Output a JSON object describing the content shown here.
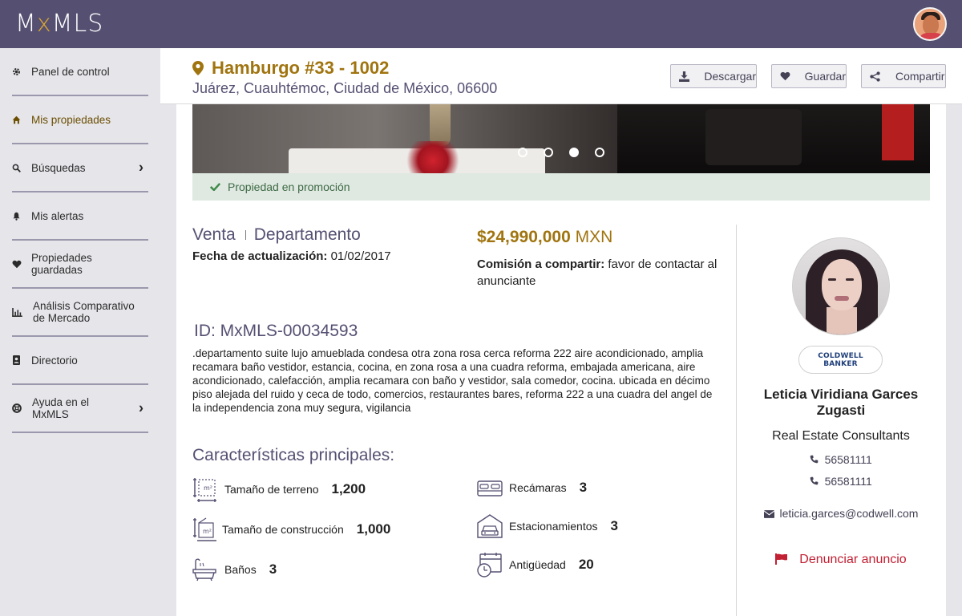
{
  "topbar": {
    "logo_prefix": "M",
    "logo_x": "x",
    "logo_suffix": "MLS"
  },
  "sidebar": {
    "items": [
      {
        "label": "Panel de control",
        "icon": "gear-icon"
      },
      {
        "label": "Mis propiedades",
        "icon": "home-icon"
      },
      {
        "label": "Búsquedas",
        "icon": "search-icon"
      },
      {
        "label": "Mis alertas",
        "icon": "bell-icon"
      },
      {
        "label": "Propiedades guardadas",
        "icon": "heart-icon"
      },
      {
        "label": "Análisis Comparativo de Mercado",
        "icon": "bar-chart-icon"
      },
      {
        "label": "Directorio",
        "icon": "contact-card-icon"
      },
      {
        "label": "Ayuda en el MxMLS",
        "icon": "lifebuoy-icon"
      }
    ]
  },
  "header": {
    "title": "Hamburgo #33 - 1002",
    "address": "Juárez, Cuauhtémoc, Ciudad de México, 06600",
    "buttons": {
      "download": "Descargar",
      "save": "Guardar",
      "share": "Compartir"
    }
  },
  "gallery": {
    "active_slide": 3,
    "total_slides": 4
  },
  "promo": {
    "text": "Propiedad en promoción"
  },
  "listing": {
    "operation": "Venta",
    "property_type": "Departamento",
    "updated_label": "Fecha de actualización:",
    "updated_value": "01/02/2017",
    "price": "$24,990,000",
    "currency": "MXN",
    "commission_label": "Comisión a compartir:",
    "commission_value": "favor de contactar al anunciante",
    "id_text": "ID: MxMLS-00034593",
    "description": ".departamento suite lujo amueblada condesa otra zona rosa cerca reforma 222 aire acondicionado, amplia recamara baño vestidor, estancia, cocina, en zona rosa a una cuadra reforma, embajada americana, aire acondicionado, calefacción, amplia recamara con baño y vestidor, sala comedor, cocina. ubicada en décimo piso alejada del ruido y ceca de todo, comercios, restaurantes bares, reforma 222 a una cuadra del angel de la independencia zona muy segura, vigilancia"
  },
  "features": {
    "title": "Características principales:",
    "lot_size": {
      "label": "Tamaño de terreno",
      "value": "1,200"
    },
    "built_size": {
      "label": "Tamaño de construcción",
      "value": "1,000"
    },
    "bathrooms": {
      "label": "Baños",
      "value": "3"
    },
    "bedrooms": {
      "label": "Recámaras",
      "value": "3"
    },
    "parking": {
      "label": "Estacionamientos",
      "value": "3"
    },
    "age": {
      "label": "Antigüedad",
      "value": "20"
    }
  },
  "agent": {
    "broker_line1": "COLDWELL",
    "broker_line2": "BANKER",
    "name": "Leticia Viridiana Garces Zugasti",
    "company": "Real Estate Consultants",
    "phone1": "56581111",
    "phone2": "56581111",
    "email": "leticia.garces@codwell.com",
    "report": "Denunciar anuncio"
  },
  "colors": {
    "topbar": "#555072",
    "accent_gold": "#a0740f",
    "title_purple": "#555072",
    "promo_bg": "#dfe8e1",
    "report_red": "#c22033"
  }
}
